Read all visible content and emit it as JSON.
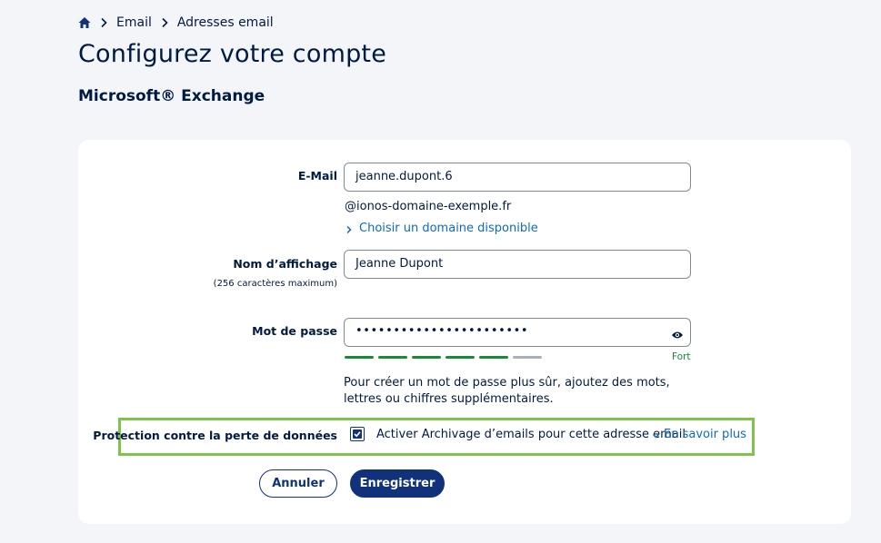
{
  "breadcrumb": {
    "home_icon": "home-icon",
    "items": [
      "Email",
      "Adresses email"
    ]
  },
  "page": {
    "title": "Configurez votre compte",
    "subtitle": "Microsoft® Exchange"
  },
  "form": {
    "email": {
      "label": "E-Mail",
      "value": "jeanne.dupont.6",
      "domain": "@ionos-domaine-exemple.fr",
      "choose_domain_link": "Choisir un domaine disponible"
    },
    "display_name": {
      "label": "Nom d’affichage",
      "hint": "(256 caractères maximum)",
      "value": "Jeanne Dupont"
    },
    "password": {
      "label": "Mot de passe",
      "masked_value": "•••••••••••••••••••••••",
      "strength_label": "Fort",
      "strength_level": 5,
      "strength_total": 6,
      "help": "Pour créer un mot de passe plus sûr, ajoutez des mots, lettres ou chiffres supplémentaires."
    },
    "data_loss": {
      "label": "Protection contre la perte de données",
      "checkbox_checked": true,
      "checkbox_label": "Activer Archivage d’emails pour cette adresse email",
      "learn_more": "En savoir plus"
    }
  },
  "buttons": {
    "cancel": "Annuler",
    "save": "Enregistrer"
  },
  "colors": {
    "primary": "#11317b",
    "link": "#0b6bc3",
    "strength_filled": "#198a3a",
    "strength_empty": "#a9b0bd",
    "highlight_border": "#7dc44b",
    "background": "#f3f5f8"
  }
}
